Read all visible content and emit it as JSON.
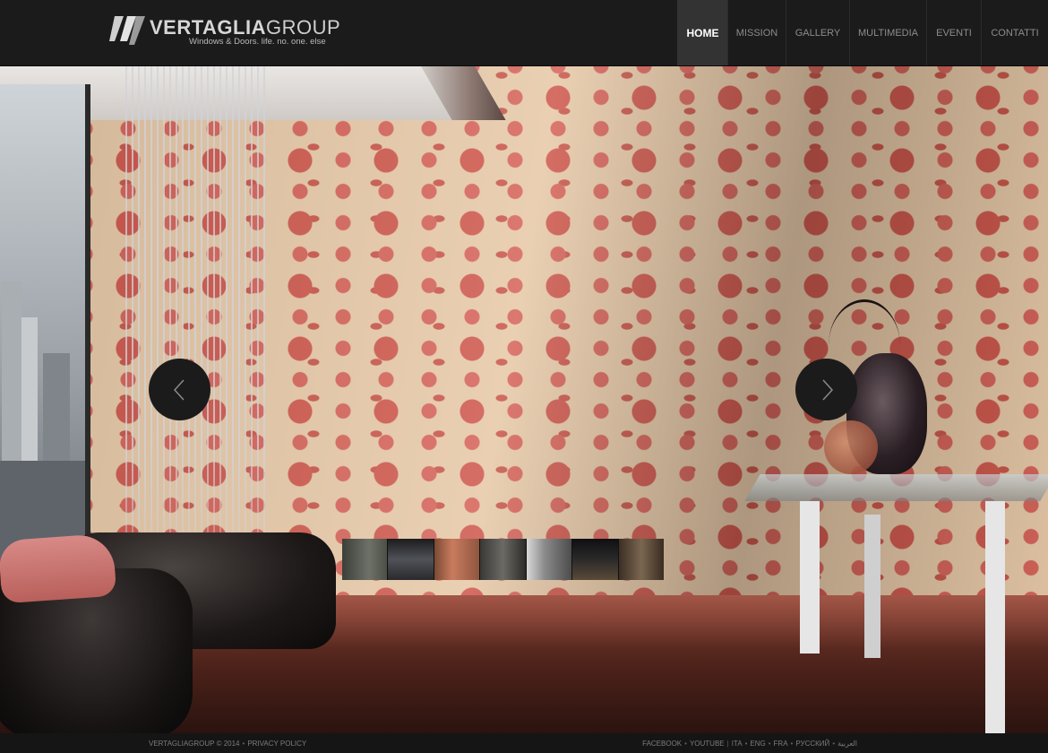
{
  "header": {
    "logo_bold": "VERTAGLIA",
    "logo_light": "GROUP",
    "tagline": "Windows & Doors. life. no. one. else"
  },
  "nav": {
    "items": [
      {
        "label": "HOME",
        "active": true
      },
      {
        "label": "MISSION",
        "active": false
      },
      {
        "label": "GALLERY",
        "active": false
      },
      {
        "label": "MULTIMEDIA",
        "active": false
      },
      {
        "label": "EVENTI",
        "active": false
      },
      {
        "label": "CONTATTI",
        "active": false
      }
    ]
  },
  "slider": {
    "prev_icon": "chevron-left-icon",
    "next_icon": "chevron-right-icon",
    "thumbnails_count": 7
  },
  "footer": {
    "copyright": "VERTAGLIAGROUP © 2014",
    "privacy": "PRIVACY POLICY",
    "links": [
      "FACEBOOK",
      "YOUTUBE",
      "ITA",
      "ENG",
      "FRA",
      "РУССКИЙ",
      "العربية"
    ]
  },
  "colors": {
    "header_bg": "#1b1b1b",
    "nav_active_bg": "#333333",
    "footer_bg": "#151515"
  }
}
